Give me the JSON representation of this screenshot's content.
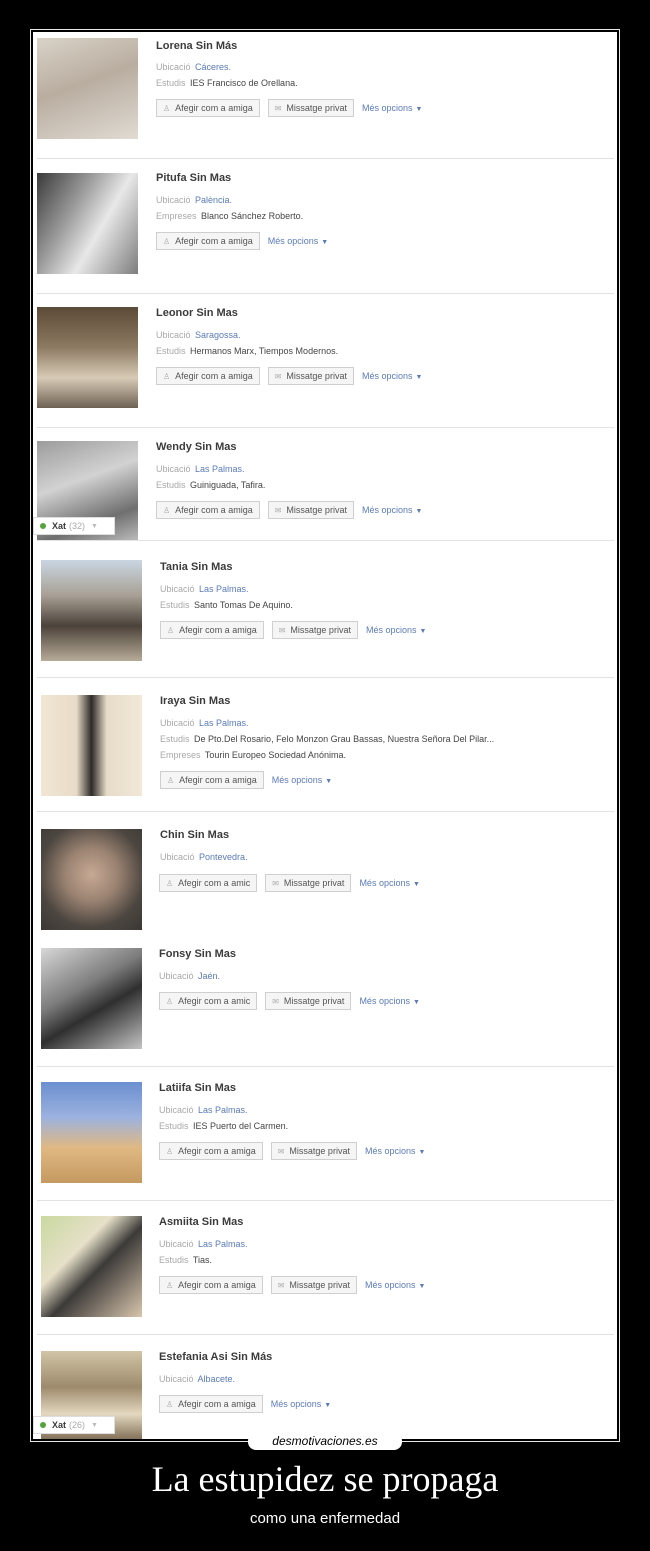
{
  "actions": {
    "add_friend": "Afegir com a amiga",
    "add_friend_short": "Afegir com a amic",
    "message": "Missatge privat",
    "more": "Més opcions"
  },
  "labels": {
    "location": "Ubicació",
    "studies": "Estudis",
    "companies": "Empreses"
  },
  "profiles": [
    {
      "name": "Lorena Sin Más",
      "location": "Cáceres.",
      "studies": "IES Francisco de Orellana."
    },
    {
      "name": "Pitufa Sin Mas",
      "location": "Palència.",
      "companies": "Blanco Sánchez Roberto."
    },
    {
      "name": "Leonor Sin Mas",
      "location": "Saragossa.",
      "studies": "Hermanos Marx, Tiempos Modernos."
    },
    {
      "name": "Wendy Sin Mas",
      "location": "Las Palmas.",
      "studies": "Guiniguada, Tafira.",
      "chat": {
        "label": "Xat",
        "count": "(32)"
      }
    },
    {
      "name": "Tania Sin Mas",
      "location": "Las Palmas.",
      "studies": "Santo Tomas De Aquino."
    },
    {
      "name": "Iraya Sin Mas",
      "location": "Las Palmas.",
      "studies": "De Pto.Del Rosario, Felo Monzon Grau Bassas, Nuestra Señora Del Pilar...",
      "companies": "Tourin Europeo Sociedad Anónima."
    },
    {
      "name": "Chin Sin Mas",
      "location": "Pontevedra."
    },
    {
      "name": "Fonsy Sin Mas",
      "location": "Jaén."
    },
    {
      "name": "Latiifa Sin Mas",
      "location": "Las Palmas.",
      "studies": "IES Puerto del Carmen."
    },
    {
      "name": "Asmiita Sin Mas",
      "location": "Las Palmas.",
      "studies": "Tias."
    },
    {
      "name": "Estefania Asi Sin Más",
      "location": "Albacete.",
      "chat": {
        "label": "Xat",
        "count": "(26)"
      }
    }
  ],
  "watermark": "desmotivaciones.es",
  "caption": {
    "title": "La estupidez se propaga",
    "subtitle": "como una enfermedad"
  }
}
